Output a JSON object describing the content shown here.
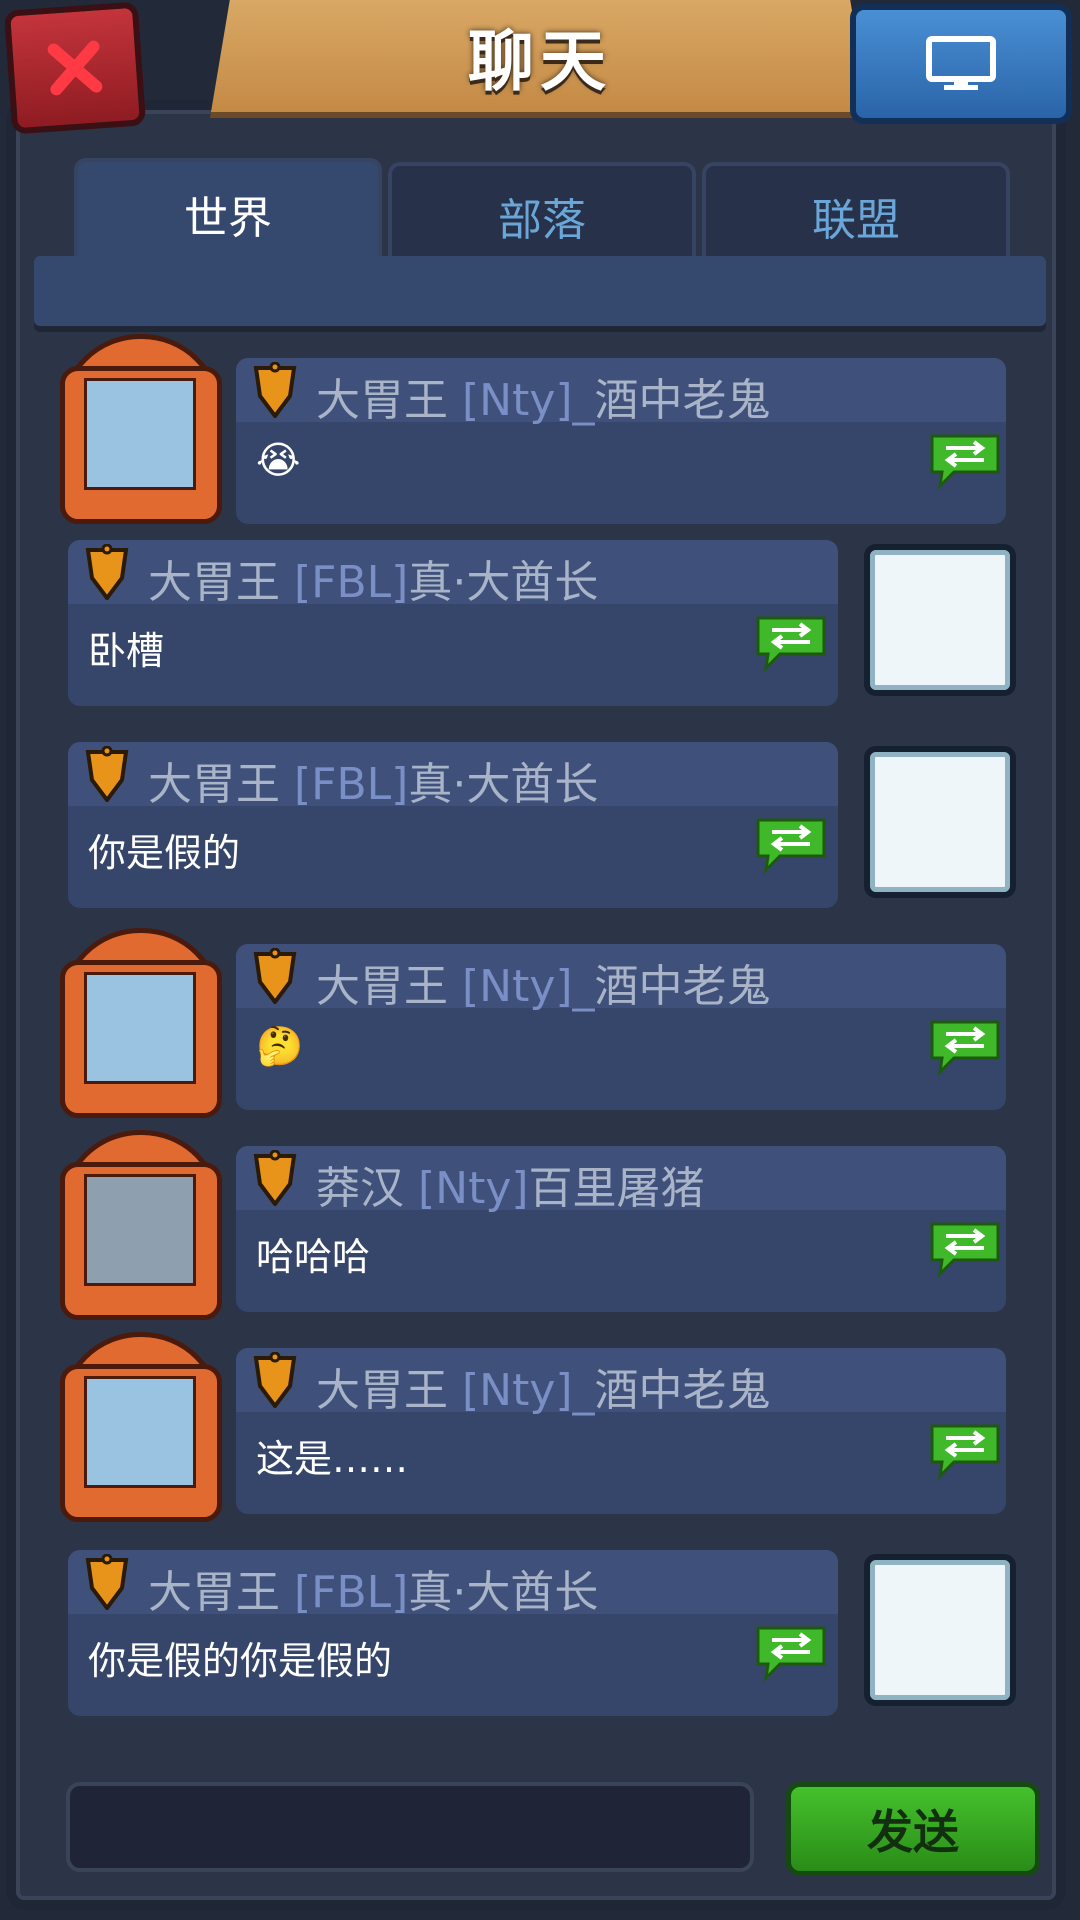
{
  "header": {
    "title": "聊天"
  },
  "tabs": [
    {
      "label": "世界",
      "active": true
    },
    {
      "label": "部落",
      "active": false
    },
    {
      "label": "联盟",
      "active": false
    }
  ],
  "messages": [
    {
      "side": "left",
      "avatar": "warrior-hero-avatar",
      "title": "大胃王",
      "tag": "[Nty]_",
      "name": "酒中老鬼",
      "text": "😭"
    },
    {
      "side": "right",
      "avatar": "bunny-king-avatar",
      "title": "大胃王",
      "tag": "[FBL]",
      "name": "真·大酋长",
      "text": "卧槽"
    },
    {
      "side": "right",
      "avatar": "bunny-king-avatar",
      "title": "大胃王",
      "tag": "[FBL]",
      "name": "真·大酋长",
      "text": "你是假的"
    },
    {
      "side": "left",
      "avatar": "warrior-hero-avatar",
      "title": "大胃王",
      "tag": "[Nty]_",
      "name": "酒中老鬼",
      "text": "🤔"
    },
    {
      "side": "left",
      "avatar": "barbarian-hero-avatar",
      "title": "莽汉",
      "tag": "[Nty]",
      "name": "百里屠猪",
      "text": "哈哈哈"
    },
    {
      "side": "left",
      "avatar": "warrior-hero-avatar",
      "title": "大胃王",
      "tag": "[Nty]_",
      "name": "酒中老鬼",
      "text": "这是……"
    },
    {
      "side": "right",
      "avatar": "bunny-king-avatar",
      "title": "大胃王",
      "tag": "[FBL]",
      "name": "真·大酋长",
      "text": "你是假的你是假的"
    }
  ],
  "input": {
    "placeholder": "",
    "send_label": "发送"
  },
  "colors": {
    "share_green": "#3fb82a",
    "shield_orange": "#e8941a",
    "bubble": "#36456a"
  }
}
